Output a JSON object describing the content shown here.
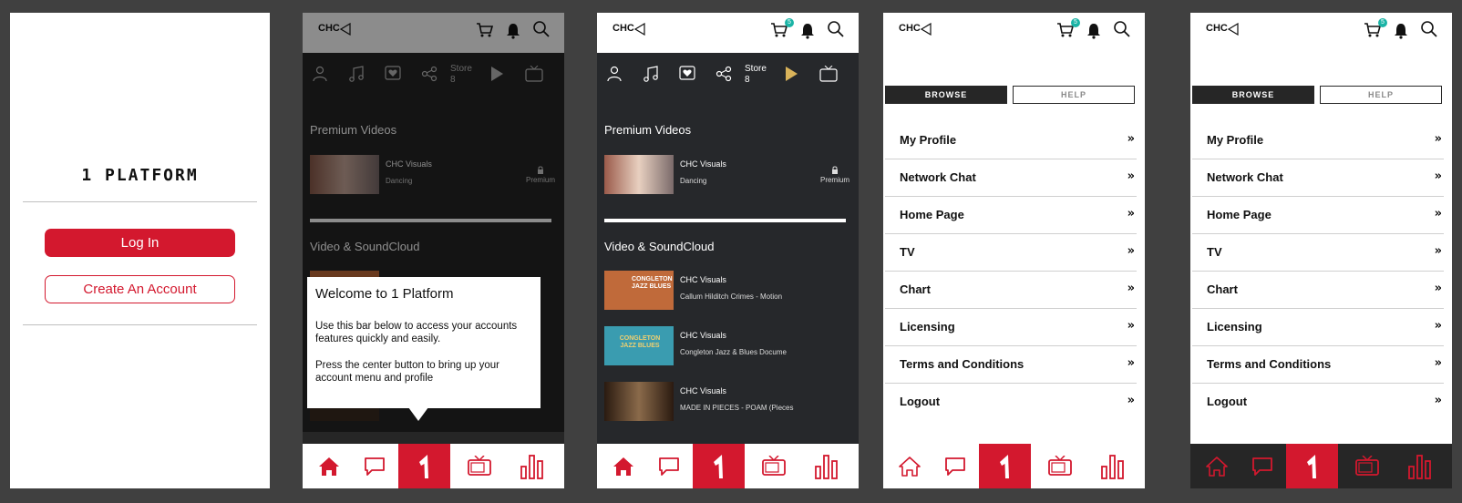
{
  "screen1": {
    "title": "1 PLATFORM",
    "login_label": "Log In",
    "create_label": "Create An Account"
  },
  "header": {
    "logo_text": "CHC",
    "cart_count": "5"
  },
  "categories": {
    "store_label": "Store",
    "store_count": "8"
  },
  "feed": {
    "section1_title": "Premium Videos",
    "premium_video": {
      "channel": "CHC Visuals",
      "title": "Dancing",
      "badge": "Premium"
    },
    "section2_title": "Video & SoundCloud",
    "videos": [
      {
        "channel": "CHC Visuals",
        "title": "Callum Hilditch Crimes - Motion"
      },
      {
        "channel": "CHC Visuals",
        "title": "Congleton Jazz & Blues Docume"
      },
      {
        "channel": "CHC Visuals",
        "title": "MADE IN PIECES - POAM (Pieces"
      }
    ],
    "thumb_texts": [
      "CONGLETON JAZZ BLUES",
      "CONGLETON JAZZ BLUES"
    ]
  },
  "popup": {
    "title": "Welcome to 1 Platform",
    "line1": "Use this bar below to access your accounts features quickly and easily.",
    "line2": "Press the center button to bring up your account menu and profile"
  },
  "menu": {
    "tab_browse": "BROWSE",
    "tab_help": "HELP",
    "items": [
      "My Profile",
      "Network Chat",
      "Home Page",
      "TV",
      "Chart",
      "Licensing",
      "Terms and Conditions",
      "Logout"
    ],
    "arrow": "»"
  },
  "nav": {
    "icons": [
      "home-icon",
      "chat-icon",
      "platform-logo-icon",
      "tv-icon",
      "chart-icon"
    ]
  },
  "colors": {
    "accent": "#d3182e",
    "dark": "#262626",
    "badge": "#1bb4a6",
    "gold": "#d9b35a"
  }
}
